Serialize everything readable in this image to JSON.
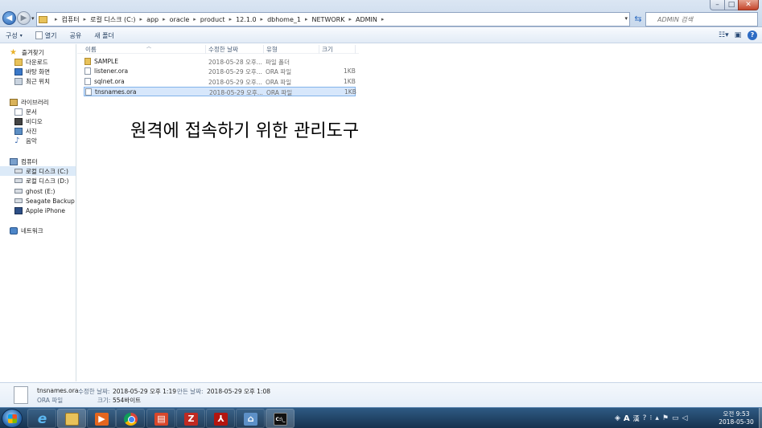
{
  "address": {
    "crumbs": [
      "컴퓨터",
      "로컬 디스크 (C:)",
      "app",
      "oracle",
      "product",
      "12.1.0",
      "dbhome_1",
      "NETWORK",
      "ADMIN"
    ]
  },
  "search": {
    "placeholder": "ADMIN 검색"
  },
  "toolbar": {
    "organize": "구성",
    "open": "열기",
    "share": "공유",
    "new_folder": "새 폴더"
  },
  "sidebar": {
    "favorites": {
      "header": "즐겨찾기",
      "items": [
        "다운로드",
        "바탕 화면",
        "최근 위치"
      ]
    },
    "libraries": {
      "header": "라이브러리",
      "items": [
        "문서",
        "비디오",
        "사진",
        "음악"
      ]
    },
    "computer": {
      "header": "컴퓨터",
      "items": [
        "로컬 디스크 (C:)",
        "로컬 디스크 (D:)",
        "ghost (E:)",
        "Seagate Backup Plu",
        "Apple iPhone"
      ]
    },
    "network": {
      "header": "네트워크"
    }
  },
  "columns": {
    "name": "이름",
    "date": "수정한 날짜",
    "type": "유형",
    "size": "크기"
  },
  "files": [
    {
      "name": "SAMPLE",
      "date": "2018-05-28 오후...",
      "type": "파일 폴더",
      "size": ""
    },
    {
      "name": "listener.ora",
      "date": "2018-05-29 오후...",
      "type": "ORA 파일",
      "size": "1KB"
    },
    {
      "name": "sqlnet.ora",
      "date": "2018-05-29 오후...",
      "type": "ORA 파일",
      "size": "1KB"
    },
    {
      "name": "tnsnames.ora",
      "date": "2018-05-29 오후...",
      "type": "ORA 파일",
      "size": "1KB"
    }
  ],
  "annotation": "원격에 접속하기 위한 관리도구",
  "details": {
    "name": "tnsnames.ora",
    "type": "ORA 파일",
    "modified_label": "수정한 날짜:",
    "modified_value": "2018-05-29 오후 1:19",
    "created_label": "만든 날짜:",
    "created_value": "2018-05-29 오후 1:08",
    "size_label": "크기:",
    "size_value": "554바이트"
  },
  "tray": {
    "ime_mode": "A",
    "ime_hanja": "漢"
  },
  "clock": {
    "time": "오전 9:53",
    "date": "2018-05-30"
  },
  "colors": {
    "selection": "#d7e7fb",
    "taskbar": "#1f4266"
  }
}
